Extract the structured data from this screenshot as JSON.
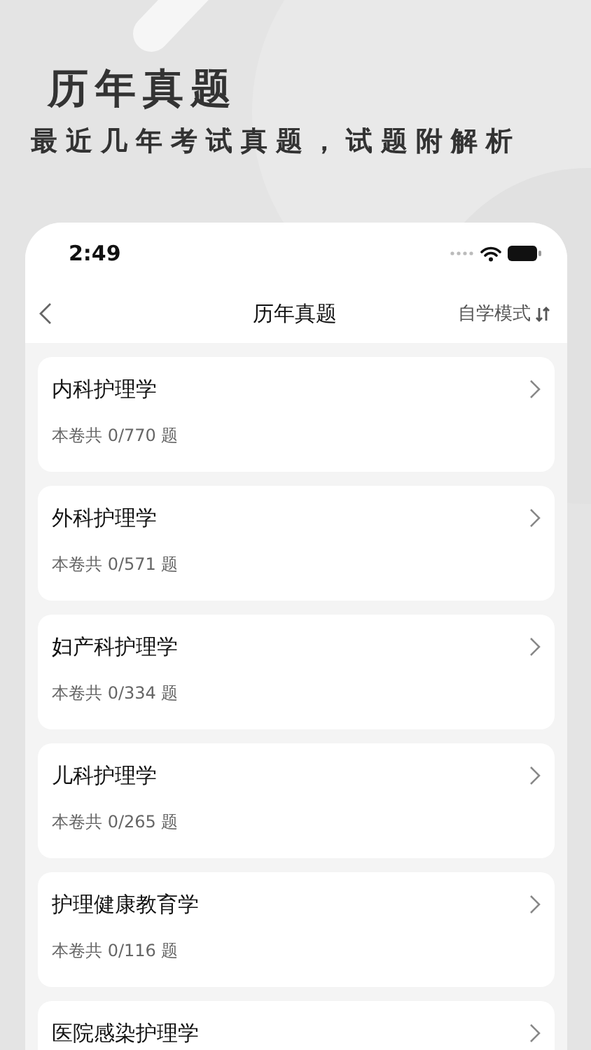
{
  "headline": {
    "title": "历年真题",
    "subtitle": "最近几年考试真题，试题附解析"
  },
  "status_bar": {
    "time": "2:49"
  },
  "nav": {
    "title": "历年真题",
    "mode": "自学模式"
  },
  "papers": [
    {
      "name": "内科护理学",
      "count": "本卷共 0/770 题"
    },
    {
      "name": "外科护理学",
      "count": "本卷共 0/571 题"
    },
    {
      "name": "妇产科护理学",
      "count": "本卷共 0/334 题"
    },
    {
      "name": "儿科护理学",
      "count": "本卷共 0/265 题"
    },
    {
      "name": "护理健康教育学",
      "count": "本卷共 0/116 题"
    },
    {
      "name": "医院感染护理学"
    }
  ]
}
